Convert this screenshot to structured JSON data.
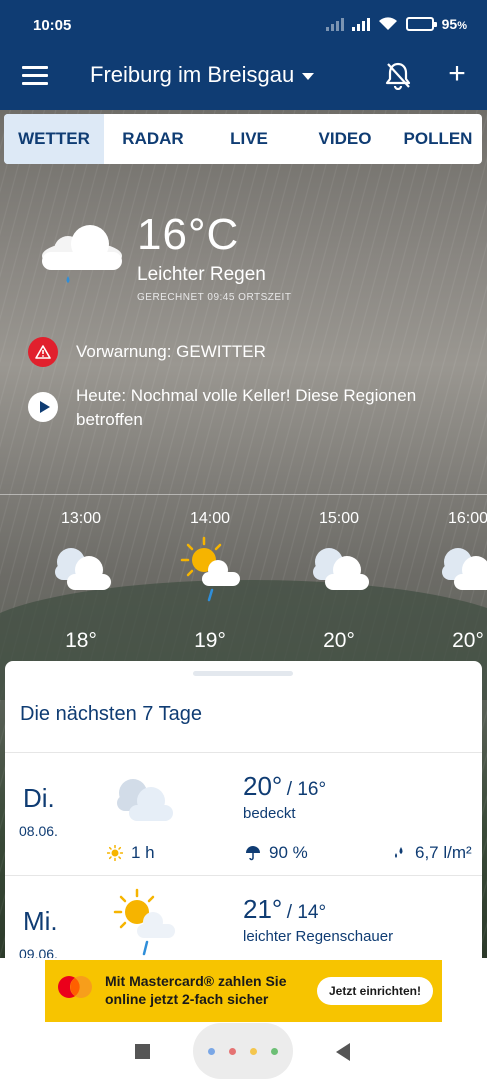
{
  "status_bar": {
    "time": "10:05",
    "battery": "95"
  },
  "app_bar": {
    "location": "Freiburg im Breisgau"
  },
  "tabs": [
    {
      "label": "WETTER",
      "active": true
    },
    {
      "label": "RADAR",
      "active": false
    },
    {
      "label": "LIVE",
      "active": false
    },
    {
      "label": "VIDEO",
      "active": false
    },
    {
      "label": "POLLEN",
      "active": false
    }
  ],
  "current": {
    "temperature": "16°C",
    "condition": "Leichter Regen",
    "calculated": "GERECHNET 09:45 ORTSZEIT",
    "icon": "cloud-rain-icon"
  },
  "warning": {
    "text": "Vorwarnung: GEWITTER",
    "icon": "warning-triangle-icon"
  },
  "news": {
    "text": "Heute: Nochmal volle Keller! Diese Regionen betroffen",
    "icon": "play-icon"
  },
  "hourly": [
    {
      "time": "13:00",
      "temp": "18°",
      "icon": "cloudy-icon"
    },
    {
      "time": "14:00",
      "temp": "19°",
      "icon": "sun-cloud-drizzle-icon"
    },
    {
      "time": "15:00",
      "temp": "20°",
      "icon": "cloudy-icon"
    },
    {
      "time": "16:00",
      "temp": "20°",
      "icon": "cloudy-icon"
    }
  ],
  "forecast": {
    "title": "Die nächsten 7 Tage",
    "days": [
      {
        "day": "Di.",
        "date": "08.06.",
        "max": "20°",
        "min": "/ 16°",
        "condition": "bedeckt",
        "sun_hours": "1 h",
        "rain_prob": "90 %",
        "rain_amount": "6,7 l/m²",
        "icon": "cloudy-icon"
      },
      {
        "day": "Mi.",
        "date": "09.06.",
        "max": "21°",
        "min": "/ 14°",
        "condition": "leichter Regenschauer",
        "icon": "sun-cloud-drizzle-icon"
      }
    ]
  },
  "ad": {
    "text": "Mit Mastercard® zahlen Sie online jetzt 2-fach sicher",
    "button": "Jetzt einrichten!"
  },
  "colors": {
    "primary": "#0f3c73",
    "tab_active_bg": "#dde9f6",
    "warning": "#e1202d",
    "ad_bg": "#f7c400"
  }
}
